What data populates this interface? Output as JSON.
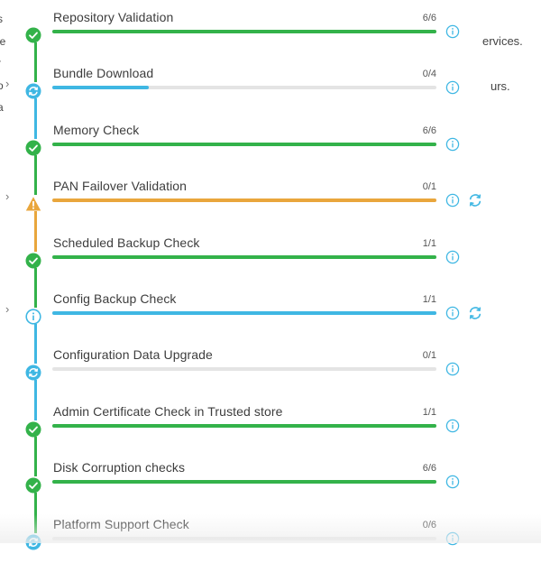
{
  "background_fragments": {
    "right_1": "ervices.",
    "right_2": "urs.",
    "left": [
      "s",
      "le",
      "r",
      "o",
      "a"
    ]
  },
  "colors": {
    "success": "#33b24a",
    "warning": "#e9a63c",
    "info": "#3fb7e3",
    "track": "#e4e4e4",
    "icon": "#3fb7e3"
  },
  "steps": [
    {
      "label": "Repository Validation",
      "count": "6/6",
      "status": "success",
      "progress": 1.0,
      "bar_color": "success",
      "expandable": false,
      "retry": false
    },
    {
      "label": "Bundle Download",
      "count": "0/4",
      "status": "in-progress",
      "progress": 0.25,
      "bar_color": "info",
      "expandable": true,
      "retry": false
    },
    {
      "label": "Memory Check",
      "count": "6/6",
      "status": "success",
      "progress": 1.0,
      "bar_color": "success",
      "expandable": false,
      "retry": false
    },
    {
      "label": "PAN Failover Validation",
      "count": "0/1",
      "status": "warning",
      "progress": 1.0,
      "bar_color": "warning",
      "expandable": true,
      "retry": true
    },
    {
      "label": "Scheduled Backup Check",
      "count": "1/1",
      "status": "success",
      "progress": 1.0,
      "bar_color": "success",
      "expandable": false,
      "retry": false
    },
    {
      "label": "Config Backup Check",
      "count": "1/1",
      "status": "info",
      "progress": 1.0,
      "bar_color": "info",
      "expandable": true,
      "retry": true
    },
    {
      "label": "Configuration Data Upgrade",
      "count": "0/1",
      "status": "in-progress",
      "progress": 0.0,
      "bar_color": "info",
      "expandable": false,
      "retry": false
    },
    {
      "label": "Admin Certificate Check in Trusted store",
      "count": "1/1",
      "status": "success",
      "progress": 1.0,
      "bar_color": "success",
      "expandable": false,
      "retry": false
    },
    {
      "label": "Disk Corruption checks",
      "count": "6/6",
      "status": "success",
      "progress": 1.0,
      "bar_color": "success",
      "expandable": false,
      "retry": false
    },
    {
      "label": "Platform Support Check",
      "count": "0/6",
      "status": "in-progress",
      "progress": 0.0,
      "bar_color": "info",
      "expandable": false,
      "retry": false
    }
  ],
  "icons": {
    "success": "check-circle-icon",
    "warning": "warning-triangle-icon",
    "info": "info-outline-circle-icon",
    "in-progress": "sync-circle-icon",
    "details": "info-icon",
    "retry": "refresh-icon",
    "expand": "chevron-right-icon"
  }
}
